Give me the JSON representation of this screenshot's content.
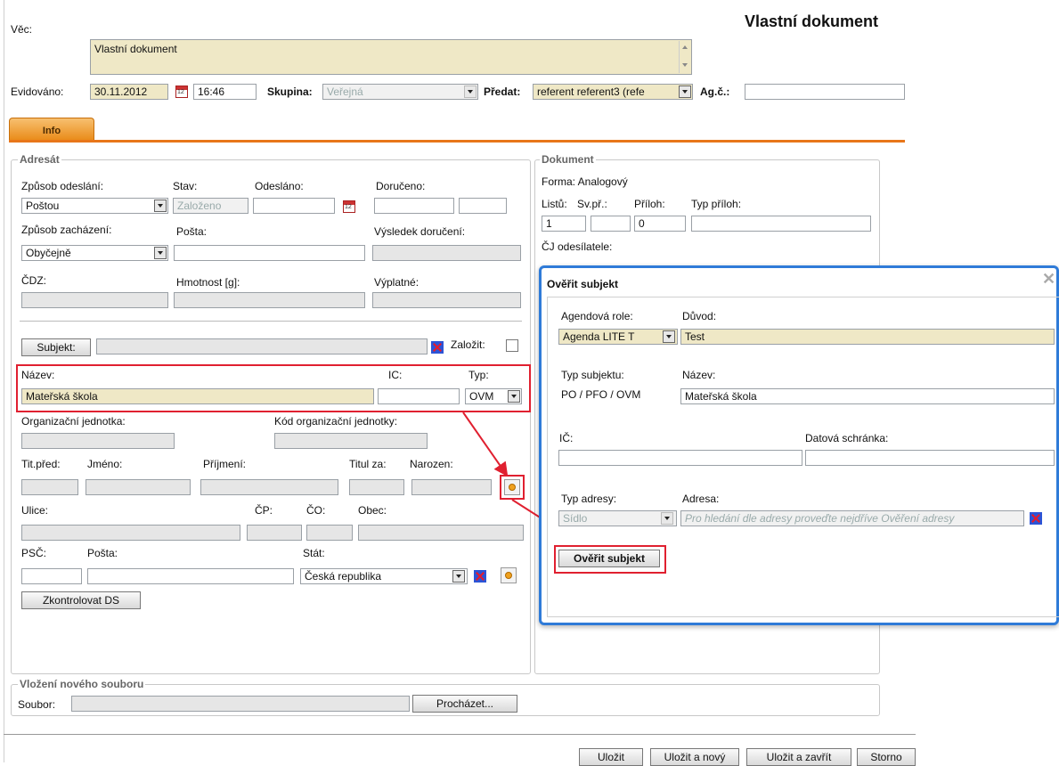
{
  "header": {
    "title": "Vlastní dokument"
  },
  "top": {
    "vec_label": "Věc:",
    "vec_value": "Vlastní dokument",
    "evidovano_label": "Evidováno:",
    "evidovano_date": "30.11.2012",
    "evidovano_time": "16:46",
    "skupina_label": "Skupina:",
    "skupina_value": "Veřejná",
    "predat_label": "Předat:",
    "predat_value": "referent referent3 (refe",
    "agc_label": "Ag.č.:",
    "agc_value": ""
  },
  "tabs": [
    {
      "label": "Info"
    }
  ],
  "adresat": {
    "legend": "Adresát",
    "zpusob_odeslani_label": "Způsob odeslání:",
    "zpusob_odeslani_value": "Poštou",
    "stav_label": "Stav:",
    "stav_value": "Založeno",
    "odeslano_label": "Odesláno:",
    "doruceno_label": "Doručeno:",
    "zpusob_zachazeni_label": "Způsob zacházení:",
    "zpusob_zachazeni_value": "Obyčejně",
    "posta_label": "Pošta:",
    "vysledek_label": "Výsledek doručení:",
    "cdz_label": "ČDZ:",
    "hmotnost_label": "Hmotnost [g]:",
    "vyplatne_label": "Výplatné:",
    "subjekt_button": "Subjekt:",
    "zalozit_label": "Založit:",
    "nazev_label": "Název:",
    "nazev_value": "Mateřská škola",
    "ic_label": "IC:",
    "typ_label": "Typ:",
    "typ_value": "OVM",
    "org_jednotka_label": "Organizační jednotka:",
    "kod_org_label": "Kód organizační jednotky:",
    "tit_pred_label": "Tit.před:",
    "jmeno_label": "Jméno:",
    "prijmeni_label": "Příjmení:",
    "titul_za_label": "Titul za:",
    "narozen_label": "Narozen:",
    "ulice_label": "Ulice:",
    "cp_label": "ČP:",
    "co_label": "ČO:",
    "obec_label": "Obec:",
    "psc_label": "PSČ:",
    "posta2_label": "Pošta:",
    "stat_label": "Stát:",
    "stat_value": "Česká republika",
    "zkontrolovat_button": "Zkontrolovat DS"
  },
  "dokument": {
    "legend": "Dokument",
    "forma": "Forma: Analogový",
    "listu_label": "Listů:",
    "svpr_label": "Sv.př.:",
    "priloh_label": "Příloh:",
    "typ_priloh_label": "Typ příloh:",
    "listu_value": "1",
    "priloh_value": "0",
    "cj_label": "ČJ odesílatele:"
  },
  "soubor": {
    "legend": "Vložení nového souboru",
    "label": "Soubor:",
    "browse_button": "Procházet..."
  },
  "footer": {
    "ulozit": "Uložit",
    "ulozit_novy": "Uložit a nový",
    "ulozit_zavrit": "Uložit a zavřít",
    "storno": "Storno"
  },
  "dialog": {
    "title": "Ověřit subjekt",
    "agendova_role_label": "Agendová role:",
    "agendova_role_value": "Agenda LITE T",
    "duvod_label": "Důvod:",
    "duvod_value": "Test",
    "typ_subjektu_label": "Typ subjektu:",
    "typ_subjektu_value": "PO / PFO / OVM",
    "nazev_label": "Název:",
    "nazev_value": "Mateřská škola",
    "ic_label": "IČ:",
    "datova_label": "Datová schránka:",
    "typ_adresy_label": "Typ adresy:",
    "typ_adresy_value": "Sídlo",
    "adresa_label": "Adresa:",
    "adresa_placeholder": "Pro hledání dle adresy proveďte nejdříve Ověření adresy",
    "submit_button": "Ověřit subjekt"
  }
}
